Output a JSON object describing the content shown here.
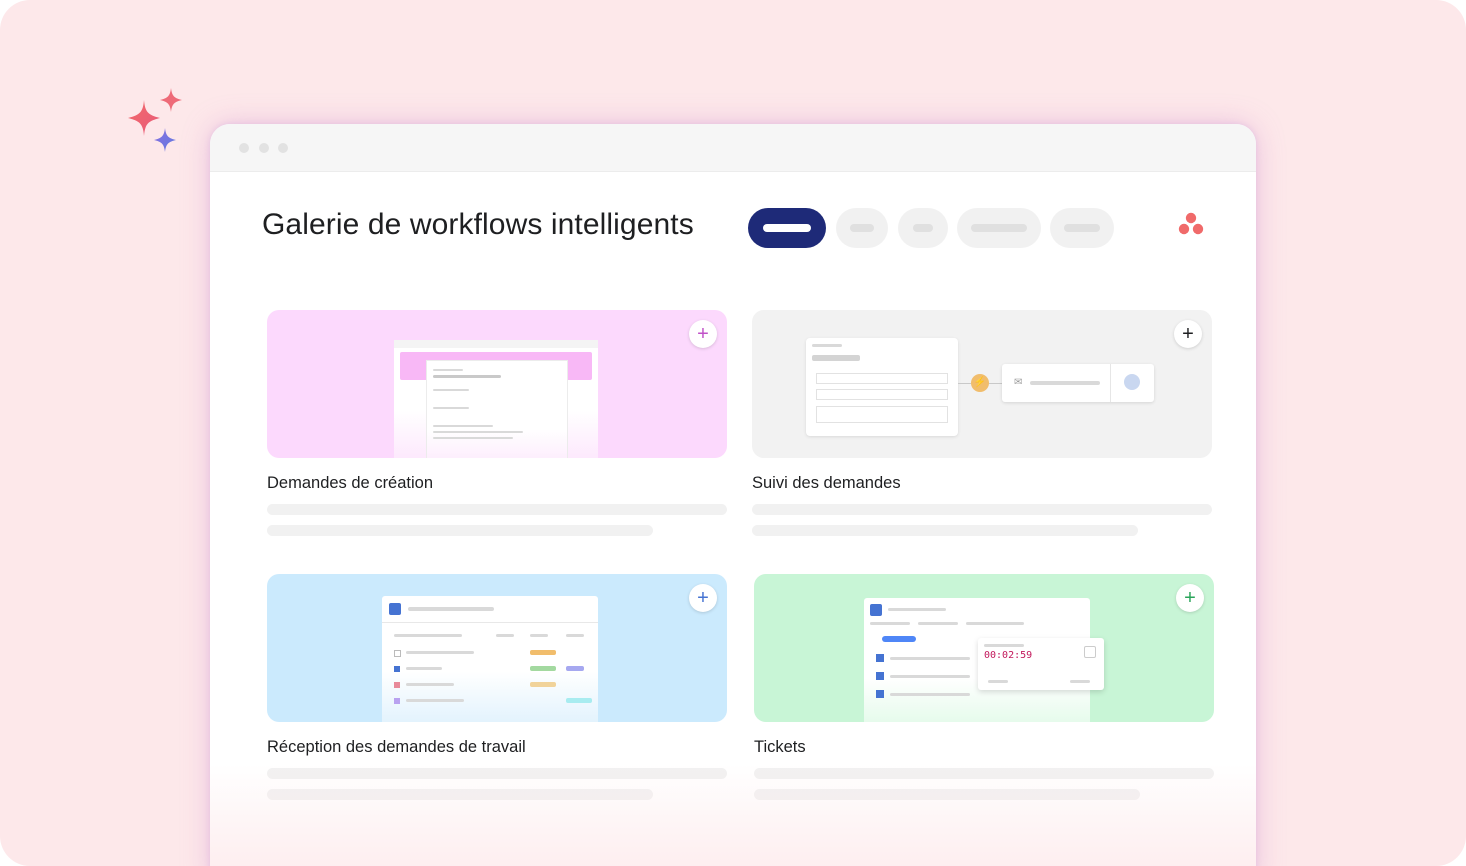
{
  "header": {
    "title": "Galerie de workflows intelligents",
    "filters": [
      "filter-1",
      "filter-2",
      "filter-3",
      "filter-4",
      "filter-5"
    ]
  },
  "icons": {
    "sparkles": "sparkles-icon",
    "logo": "asana-logo-icon",
    "add": "plus-icon"
  },
  "cards": [
    {
      "title": "Demandes de création",
      "accent": "#fcd9fd",
      "plus_color": "#c052c8"
    },
    {
      "title": "Suivi des demandes",
      "accent": "#f2f2f2",
      "plus_color": "#1e1f21"
    },
    {
      "title": "Réception des demandes de travail",
      "accent": "#cbeafd",
      "plus_color": "#4573d2"
    },
    {
      "title": "Tickets",
      "accent": "#c8f5d6",
      "plus_color": "#2aa55a"
    }
  ],
  "timer": {
    "value": "00:02:59"
  },
  "plus_symbol": "+",
  "colors": {
    "background": "#fde8ea",
    "active_filter": "#1e2a78",
    "logo": "#f06a6a"
  }
}
